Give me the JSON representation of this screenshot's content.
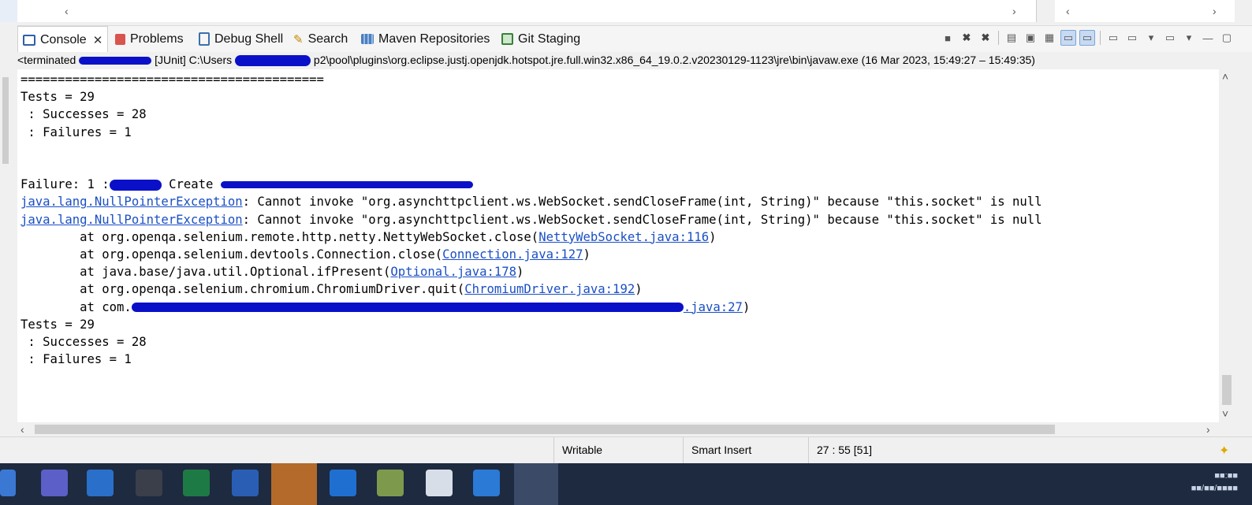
{
  "tabs": [
    {
      "label": "Console",
      "icon": "console-icon",
      "active": true
    },
    {
      "label": "Problems",
      "icon": "problems-icon"
    },
    {
      "label": "Debug Shell",
      "icon": "debug-shell-icon"
    },
    {
      "label": "Search",
      "icon": "search-icon"
    },
    {
      "label": "Maven Repositories",
      "icon": "maven-icon"
    },
    {
      "label": "Git Staging",
      "icon": "git-staging-icon"
    }
  ],
  "process": {
    "prefix": "<terminated",
    "type": "[JUnit] C:\\Users",
    "path": "p2\\pool\\plugins\\org.eclipse.justj.openjdk.hotspot.jre.full.win32.x86_64_19.0.2.v20230129-1123\\jre\\bin\\javaw.exe  (16 Mar 2023, 15:49:27 – 15:49:35)"
  },
  "console": {
    "separator": "=========================================",
    "tests1": "Tests = 29",
    "successes1": " : Successes = 28",
    "failures1": " : Failures = 1",
    "failure_prefix": "Failure: 1 :",
    "failure_create": "Create",
    "exception_link": "java.lang.NullPointerException",
    "exception_msg": ": Cannot invoke \"org.asynchttpclient.ws.WebSocket.sendCloseFrame(int, String)\" because \"this.socket\" is null",
    "trace": [
      {
        "prefix": "        at org.openqa.selenium.remote.http.netty.NettyWebSocket.close(",
        "link": "NettyWebSocket.java:116",
        "suffix": ")"
      },
      {
        "prefix": "        at org.openqa.selenium.devtools.Connection.close(",
        "link": "Connection.java:127",
        "suffix": ")"
      },
      {
        "prefix": "        at java.base/java.util.Optional.ifPresent(",
        "link": "Optional.java:178",
        "suffix": ")"
      },
      {
        "prefix": "        at org.openqa.selenium.chromium.ChromiumDriver.quit(",
        "link": "ChromiumDriver.java:192",
        "suffix": ")"
      },
      {
        "prefix": "        at com.",
        "link": ".java:27",
        "suffix": ")"
      }
    ],
    "tests2": "Tests = 29",
    "successes2": " : Successes = 28",
    "failures2": " : Failures = 1"
  },
  "status": {
    "mode": "Writable",
    "insert": "Smart Insert",
    "position": "27 : 55 [51]"
  }
}
